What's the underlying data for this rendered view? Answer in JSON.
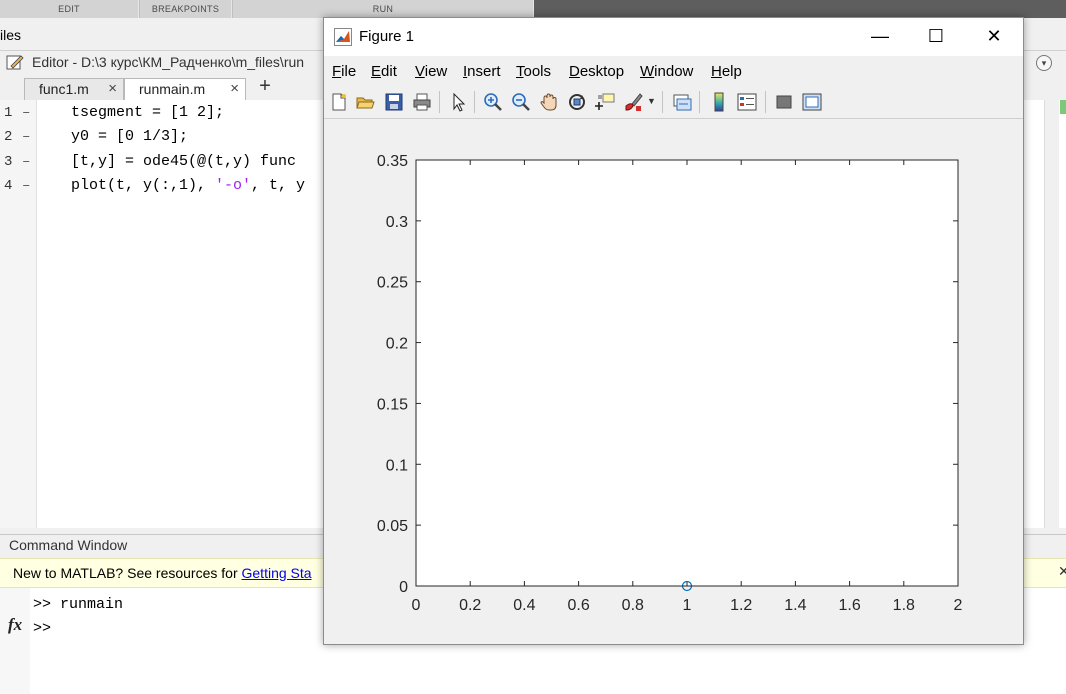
{
  "toolstrip": {
    "sections": [
      "EDIT",
      "BREAKPOINTS",
      "RUN"
    ]
  },
  "files_panel": {
    "label": "iles"
  },
  "editor": {
    "title": "Editor - D:\\3 курс\\КМ_Радченко\\m_files\\run",
    "tabs": [
      {
        "label": "func1.m",
        "active": false
      },
      {
        "label": "runmain.m",
        "active": true
      }
    ],
    "new_tab_label": "+",
    "lines": [
      {
        "num": "1",
        "code": "tsegment = [1 2];"
      },
      {
        "num": "2",
        "code": "y0 = [0 1/3];"
      },
      {
        "num": "3",
        "code": "[t,y] = ode45(@(t,y) func"
      },
      {
        "num": "4",
        "code_pre": "plot(t, y(:,1), ",
        "code_str": "'-o'",
        "code_post": ", t, y"
      }
    ]
  },
  "command_window": {
    "title": "Command Window",
    "banner_text": "New to MATLAB? See resources for ",
    "banner_link": "Getting Sta",
    "lines": [
      ">> runmain",
      ">>"
    ],
    "fx_label": "fx"
  },
  "figure": {
    "title": "Figure 1",
    "menus": [
      {
        "label": "File",
        "key": "F",
        "rest": "ile"
      },
      {
        "label": "Edit",
        "key": "E",
        "rest": "dit"
      },
      {
        "label": "View",
        "key": "V",
        "rest": "iew"
      },
      {
        "label": "Insert",
        "key": "I",
        "rest": "nsert"
      },
      {
        "label": "Tools",
        "key": "T",
        "rest": "ools"
      },
      {
        "label": "Desktop",
        "key": "D",
        "rest": "esktop"
      },
      {
        "label": "Window",
        "key": "W",
        "rest": "indow"
      },
      {
        "label": "Help",
        "key": "H",
        "rest": "elp"
      }
    ],
    "window_buttons": {
      "minimize": "—",
      "maximize": "☐",
      "close": "✕"
    },
    "toolbar_icons": [
      "new-figure-icon",
      "open-file-icon",
      "save-icon",
      "print-icon",
      "edit-plot-arrow-icon",
      "zoom-in-icon",
      "zoom-out-icon",
      "pan-hand-icon",
      "rotate-3d-icon",
      "data-cursor-icon",
      "brush-icon",
      "link-plot-icon",
      "colorbar-icon",
      "legend-icon",
      "hide-plot-tools-icon",
      "show-plot-tools-icon"
    ],
    "accent_color": "#0072bd"
  },
  "chart_data": {
    "type": "line",
    "series": [
      {
        "x": [
          1
        ],
        "y": [
          0
        ],
        "marker": "o",
        "line": "-",
        "color": "#0072bd"
      }
    ],
    "xlim": [
      0,
      2
    ],
    "ylim": [
      0,
      0.35
    ],
    "xticks": [
      "0",
      "0.2",
      "0.4",
      "0.6",
      "0.8",
      "1",
      "1.2",
      "1.4",
      "1.6",
      "1.8",
      "2"
    ],
    "yticks": [
      "0",
      "0.05",
      "0.1",
      "0.15",
      "0.2",
      "0.25",
      "0.3",
      "0.35"
    ],
    "grid": false,
    "title": "",
    "xlabel": "",
    "ylabel": ""
  }
}
